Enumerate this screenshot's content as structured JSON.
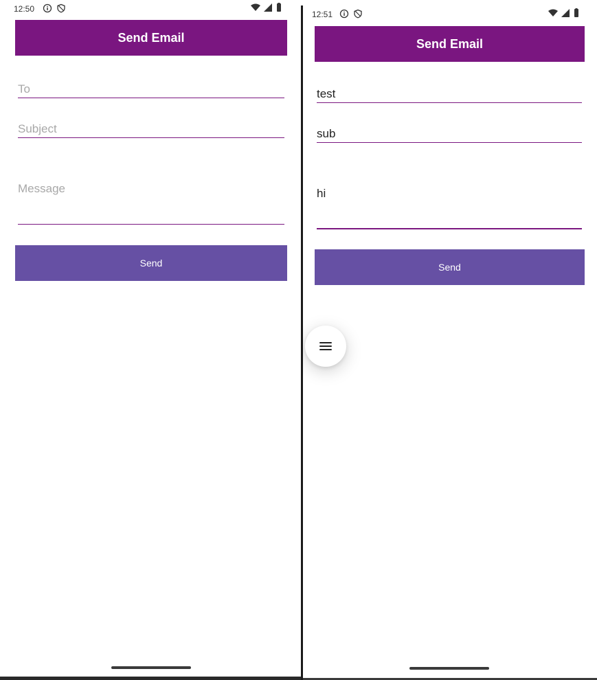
{
  "left_screen": {
    "status": {
      "time": "12:50"
    },
    "app_bar": {
      "title": "Send Email"
    },
    "fields": {
      "to_placeholder": "To",
      "subject_placeholder": "Subject",
      "message_placeholder": "Message"
    },
    "send_label": "Send"
  },
  "right_screen": {
    "status": {
      "time": "12:51"
    },
    "app_bar": {
      "title": "Send Email"
    },
    "fields": {
      "to_value": "test",
      "subject_value": "sub",
      "message_value": "hi"
    },
    "send_label": "Send",
    "fab_icon": "menu-icon"
  },
  "colors": {
    "app_bar": "#7a1680",
    "send_button": "#6650a4",
    "field_underline": "#7a1680",
    "placeholder_text": "#a8a8a8"
  }
}
